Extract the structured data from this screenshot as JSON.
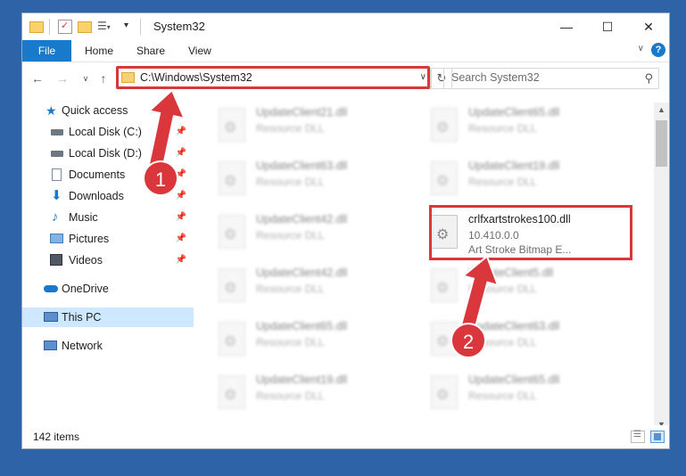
{
  "window": {
    "title": "System32",
    "controls": {
      "minimize": "—",
      "maximize": "☐",
      "close": "✕"
    }
  },
  "ribbon": {
    "tabs": [
      {
        "label": "File",
        "active": true
      },
      {
        "label": "Home"
      },
      {
        "label": "Share"
      },
      {
        "label": "View"
      }
    ],
    "help": "?"
  },
  "address": {
    "path": "C:\\Windows\\System32",
    "search_placeholder": "Search System32"
  },
  "navigation": {
    "items": [
      {
        "label": "Quick access",
        "icon": "star-icon"
      },
      {
        "label": "Local Disk (C:)",
        "icon": "drive-icon",
        "pinned": true
      },
      {
        "label": "Local Disk (D:)",
        "icon": "drive-icon",
        "pinned": true
      },
      {
        "label": "Documents",
        "icon": "documents-icon",
        "pinned": true
      },
      {
        "label": "Downloads",
        "icon": "downloads-icon",
        "pinned": true
      },
      {
        "label": "Music",
        "icon": "music-icon",
        "pinned": true
      },
      {
        "label": "Pictures",
        "icon": "pictures-icon",
        "pinned": true
      },
      {
        "label": "Videos",
        "icon": "videos-icon",
        "pinned": true
      },
      {
        "label": "OneDrive",
        "icon": "onedrive-icon"
      },
      {
        "label": "This PC",
        "icon": "this-pc-icon",
        "selected": true
      },
      {
        "label": "Network",
        "icon": "network-icon"
      }
    ]
  },
  "files": {
    "left_column": [
      {
        "name": "UpdateClient21.dll",
        "type": "Resource DLL"
      },
      {
        "name": "UpdateClient63.dll",
        "type": "Resource DLL"
      },
      {
        "name": "UpdateClient42.dll",
        "type": "Resource DLL"
      },
      {
        "name": "UpdateClient42.dll",
        "type": "Resource DLL"
      },
      {
        "name": "UpdateClient65.dll",
        "type": "Resource DLL"
      },
      {
        "name": "UpdateClient19.dll",
        "type": "Resource DLL"
      }
    ],
    "right_column": [
      {
        "name": "UpdateClient65.dll",
        "type": "Resource DLL"
      },
      {
        "name": "UpdateClient19.dll",
        "type": "Resource DLL"
      },
      {
        "name": "crlfxartstrokes100.dll",
        "version": "10.410.0.0",
        "description": "Art Stroke Bitmap E...",
        "highlighted": true
      },
      {
        "name": "UpdateClient5.dll",
        "type": "Resource DLL"
      },
      {
        "name": "UpdateClient63.dll",
        "type": "Resource DLL"
      },
      {
        "name": "UpdateClient65.dll",
        "type": "Resource DLL"
      }
    ]
  },
  "status": {
    "item_count": "142 items"
  },
  "annotations": {
    "step1": "1",
    "step2": "2"
  },
  "colors": {
    "highlight": "#d9373b",
    "accent": "#1979ca",
    "desktop": "#2f63a8"
  }
}
